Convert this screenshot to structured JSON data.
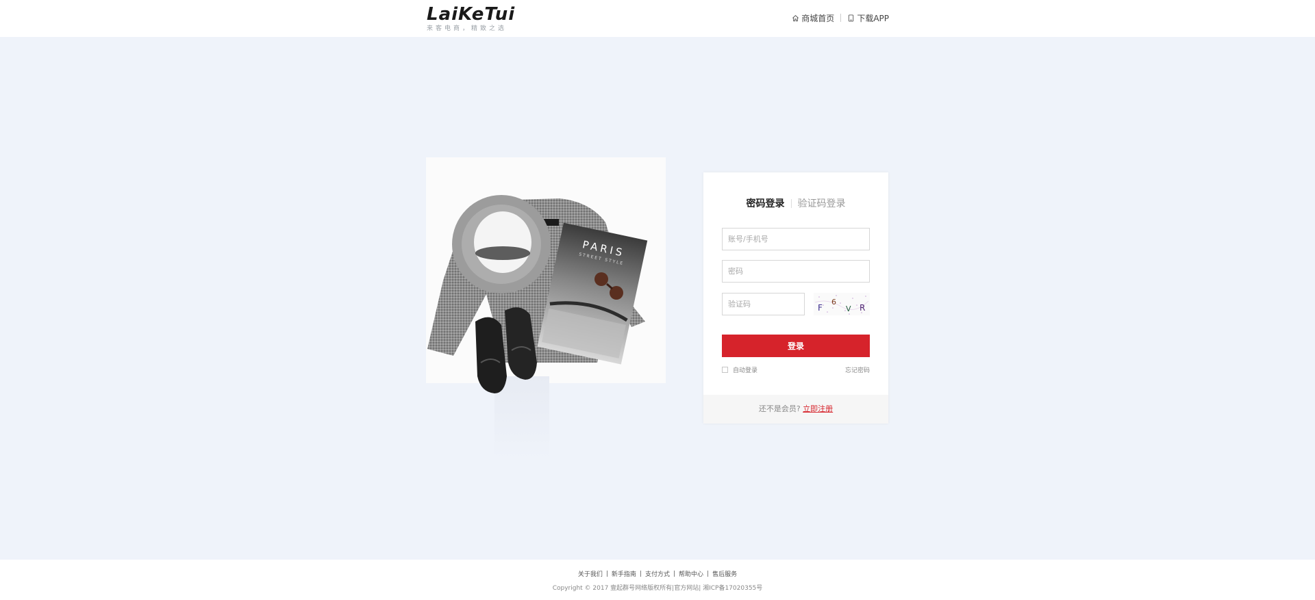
{
  "header": {
    "logo_text": "LaiKeTui",
    "logo_slogan": "来客电商，精致之选",
    "nav": [
      {
        "label": "商城首页",
        "icon": "home-icon"
      },
      {
        "label": "下载APP",
        "icon": "mobile-icon"
      }
    ]
  },
  "login": {
    "tabs": [
      {
        "label": "密码登录",
        "active": true
      },
      {
        "label": "验证码登录",
        "active": false
      }
    ],
    "account_placeholder": "账号/手机号",
    "password_placeholder": "密码",
    "captcha_placeholder": "验证码",
    "captcha_chars": [
      "F",
      "6",
      "V",
      "R"
    ],
    "submit_label": "登录",
    "auto_login_label": "自动登录",
    "forgot_label": "忘记密码",
    "register_prompt": "还不是会员?",
    "register_link": "立即注册"
  },
  "footer": {
    "links": [
      "关于我们",
      "新手指南",
      "支付方式",
      "帮助中心",
      "售后服务"
    ],
    "copyright": "Copyright © 2017 壹起群号网络版权所有|官方网站|  湘ICP备17020355号"
  },
  "colors": {
    "accent": "#d6232b",
    "background": "#eff3fa"
  }
}
